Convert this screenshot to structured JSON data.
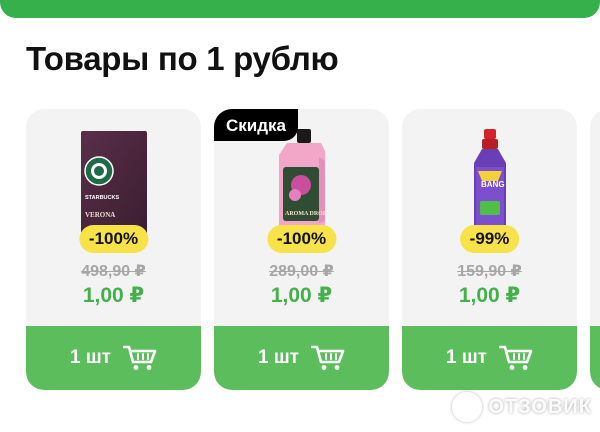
{
  "section": {
    "title": "Товары по 1 рублю"
  },
  "products": [
    {
      "name": "Starbucks Verona",
      "brand_text": "STARBUCKS",
      "variety_text": "VERONA",
      "discount": "-100%",
      "old_price": "498,90 ₽",
      "new_price": "1,00 ₽",
      "cart_label": "1 шт",
      "sale_badge": ""
    },
    {
      "name": "Aroma Drop",
      "brand_text": "AROMA DROP",
      "discount": "-100%",
      "old_price": "289,00 ₽",
      "new_price": "1,00 ₽",
      "cart_label": "1 шт",
      "sale_badge": "Скидка"
    },
    {
      "name": "Cillit Bang",
      "brand_text": "BANG",
      "discount": "-99%",
      "old_price": "159,90 ₽",
      "new_price": "1,00 ₽",
      "cart_label": "1 шт",
      "sale_badge": ""
    }
  ],
  "watermark": {
    "text": "ОТЗОВИК"
  },
  "colors": {
    "accent_green": "#5cbd5c",
    "price_green": "#43b04a",
    "discount_yellow": "#f7e24a",
    "old_price_gray": "#a6a6a6"
  },
  "icons": {
    "cart": "cart-icon"
  }
}
